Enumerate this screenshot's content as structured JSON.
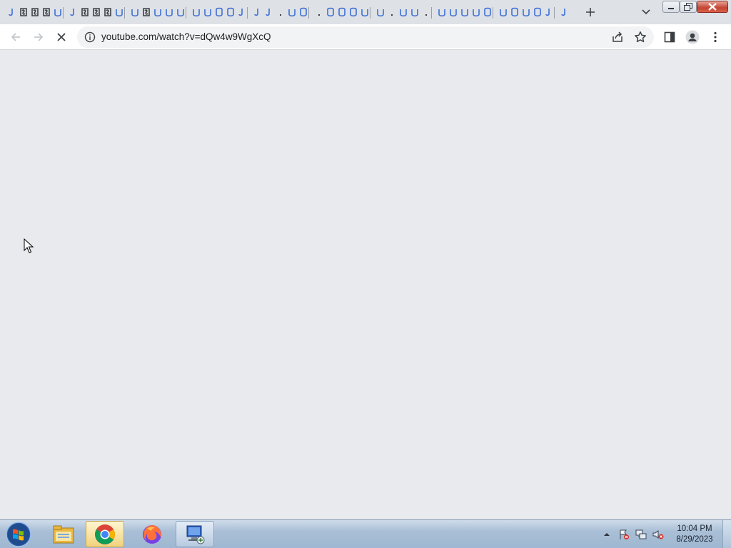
{
  "browser": {
    "tab_count_hint": "many",
    "address_bar": {
      "url": "youtube.com/watch?v=dQw4w9WgXcQ"
    },
    "toolbar_icons": [
      "back-icon",
      "forward-icon",
      "stop-icon",
      "info-icon",
      "share-icon",
      "star-icon",
      "side-panel-icon",
      "profile-icon",
      "menu-icon"
    ],
    "tabstrip_icons": [
      "new-tab-icon",
      "tab-search-icon"
    ],
    "window_controls": [
      "minimize-icon",
      "restore-icon",
      "close-icon"
    ]
  },
  "taskbar": {
    "apps": [
      "windows-start-icon",
      "file-explorer-icon",
      "chrome-icon",
      "firefox-icon",
      "remote-desktop-icon"
    ],
    "active_app": "chrome-icon",
    "tray_icons": [
      "show-hidden-icons-icon",
      "action-center-icon",
      "network-icon",
      "volume-muted-icon"
    ],
    "clock": {
      "time": "10:04 PM",
      "date": "8/29/2023"
    }
  },
  "colors": {
    "tabstrip": "#dee1e6",
    "page_background": "#e8eaed",
    "favicon_blue": "#3d6fd6",
    "favicon_dark": "#3c4043"
  }
}
